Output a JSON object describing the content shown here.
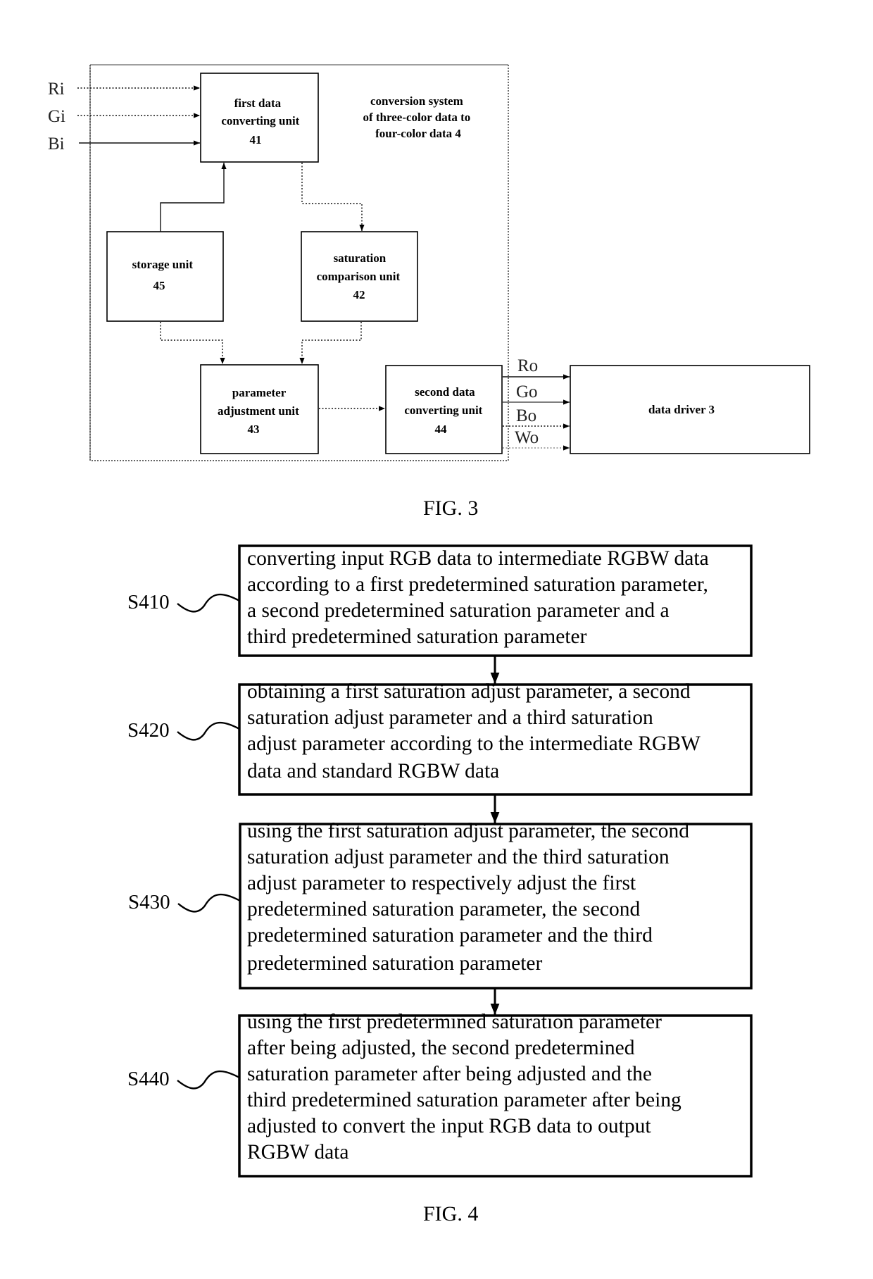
{
  "fig3": {
    "caption": "FIG. 3",
    "container_label": [
      "conversion system",
      "of three-color data to",
      "four-color data 4"
    ],
    "inputs": [
      "Ri",
      "Gi",
      "Bi"
    ],
    "outputs": [
      "Ro",
      "Go",
      "Bo",
      "Wo"
    ],
    "blocks": {
      "first_converter": [
        "first data",
        "converting unit",
        "41"
      ],
      "saturation_comparison": [
        "saturation",
        "comparison unit",
        "42"
      ],
      "parameter_adjustment": [
        "parameter",
        "adjustment unit",
        "43"
      ],
      "second_converter": [
        "second data",
        "converting unit",
        "44"
      ],
      "storage": [
        "storage unit",
        "45"
      ],
      "data_driver": [
        "data driver 3"
      ]
    }
  },
  "fig4": {
    "caption": "FIG. 4",
    "steps": [
      {
        "id": "S410",
        "lines": [
          "converting input RGB data to intermediate RGBW data",
          "according to a first predetermined saturation parameter,",
          "a second predetermined saturation parameter and a",
          "third predetermined saturation parameter"
        ]
      },
      {
        "id": "S420",
        "lines": [
          "obtaining a first saturation adjust parameter, a second",
          "saturation adjust parameter and a third saturation",
          "adjust parameter according to the intermediate RGBW",
          "data and standard RGBW data"
        ]
      },
      {
        "id": "S430",
        "lines": [
          "using the first saturation adjust parameter, the second",
          "saturation adjust parameter and the third saturation",
          "adjust parameter to respectively adjust the first",
          "predetermined saturation parameter, the second",
          "predetermined saturation parameter and the third",
          "predetermined saturation parameter"
        ]
      },
      {
        "id": "S440",
        "lines": [
          "using the first predetermined saturation parameter",
          "after being adjusted, the second predetermined",
          "saturation parameter after being adjusted and the",
          "third predetermined saturation parameter after being",
          "adjusted to convert the input RGB data to output",
          "RGBW data"
        ]
      }
    ]
  }
}
